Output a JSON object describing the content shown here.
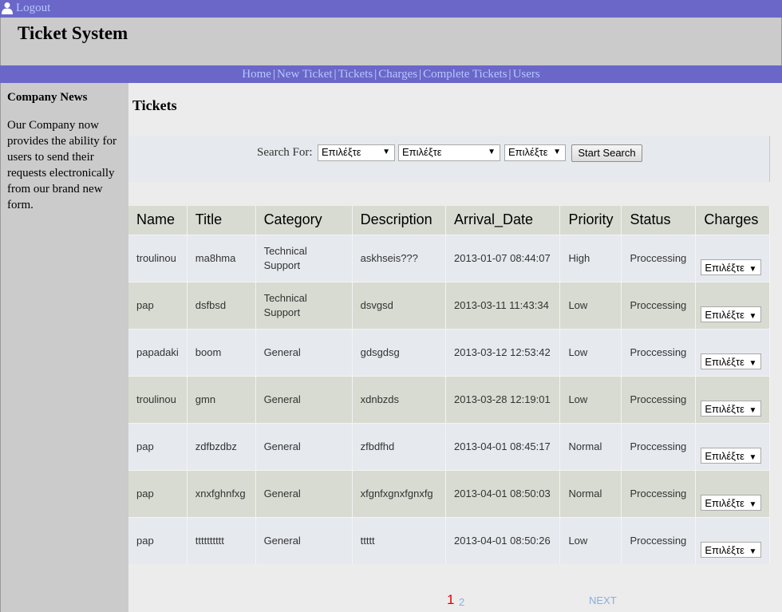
{
  "topbar": {
    "user_icon": "user-icon",
    "logout_label": "Logout"
  },
  "header": {
    "title": "Ticket System"
  },
  "nav": {
    "items": [
      "Home",
      "New Ticket",
      "Tickets",
      "Charges",
      "Complete Tickets",
      "Users"
    ],
    "separator": "|"
  },
  "sidebar": {
    "heading": "Company News",
    "text": "Our Company now provides the ability for users to send their requests electronically from our brand new form."
  },
  "main": {
    "title": "Tickets",
    "search": {
      "label": "Search For:",
      "selects": [
        "Επιλέξτε",
        "Επιλέξτε",
        "Επιλέξτε"
      ],
      "button_label": "Start Search"
    },
    "table": {
      "columns": [
        "Name",
        "Title",
        "Category",
        "Description",
        "Arrival_Date",
        "Priority",
        "Status",
        "Charges"
      ],
      "rows": [
        [
          "troulinou",
          "ma8hma",
          "Technical Support",
          "askhseis???",
          "2013-01-07 08:44:07",
          "High",
          "Proccessing",
          "Επιλέξτε"
        ],
        [
          "pap",
          "dsfbsd",
          "Technical Support",
          "dsvgsd",
          "2013-03-11 11:43:34",
          "Low",
          "Proccessing",
          "Επιλέξτε"
        ],
        [
          "papadaki",
          "boom",
          "General",
          "gdsgdsg",
          "2013-03-12 12:53:42",
          "Low",
          "Proccessing",
          "Επιλέξτε"
        ],
        [
          "troulinou",
          "gmn",
          "General",
          "xdnbzds",
          "2013-03-28 12:19:01",
          "Low",
          "Proccessing",
          "Επιλέξτε"
        ],
        [
          "pap",
          "zdfbzdbz",
          "General",
          "zfbdfhd",
          "2013-04-01 08:45:17",
          "Normal",
          "Proccessing",
          "Επιλέξτε"
        ],
        [
          "pap",
          "xnxfghnfxg",
          "General",
          "xfgnfxgnxfgnxfg",
          "2013-04-01 08:50:03",
          "Normal",
          "Proccessing",
          "Επιλέξτε"
        ],
        [
          "pap",
          "tttttttttt",
          "General",
          "ttttt",
          "2013-04-01 08:50:26",
          "Low",
          "Proccessing",
          "Επιλέξτε"
        ]
      ]
    },
    "pager": {
      "current": "1",
      "other": "2",
      "next_label": "NEXT"
    }
  },
  "colors": {
    "nav_bar": "#6a67c9",
    "header_bg": "#cbcbcb",
    "row_odd": "#e6e9ee",
    "row_even": "#d7dbd1",
    "pager_current": "#e00000",
    "link": "#b8c6ff"
  }
}
